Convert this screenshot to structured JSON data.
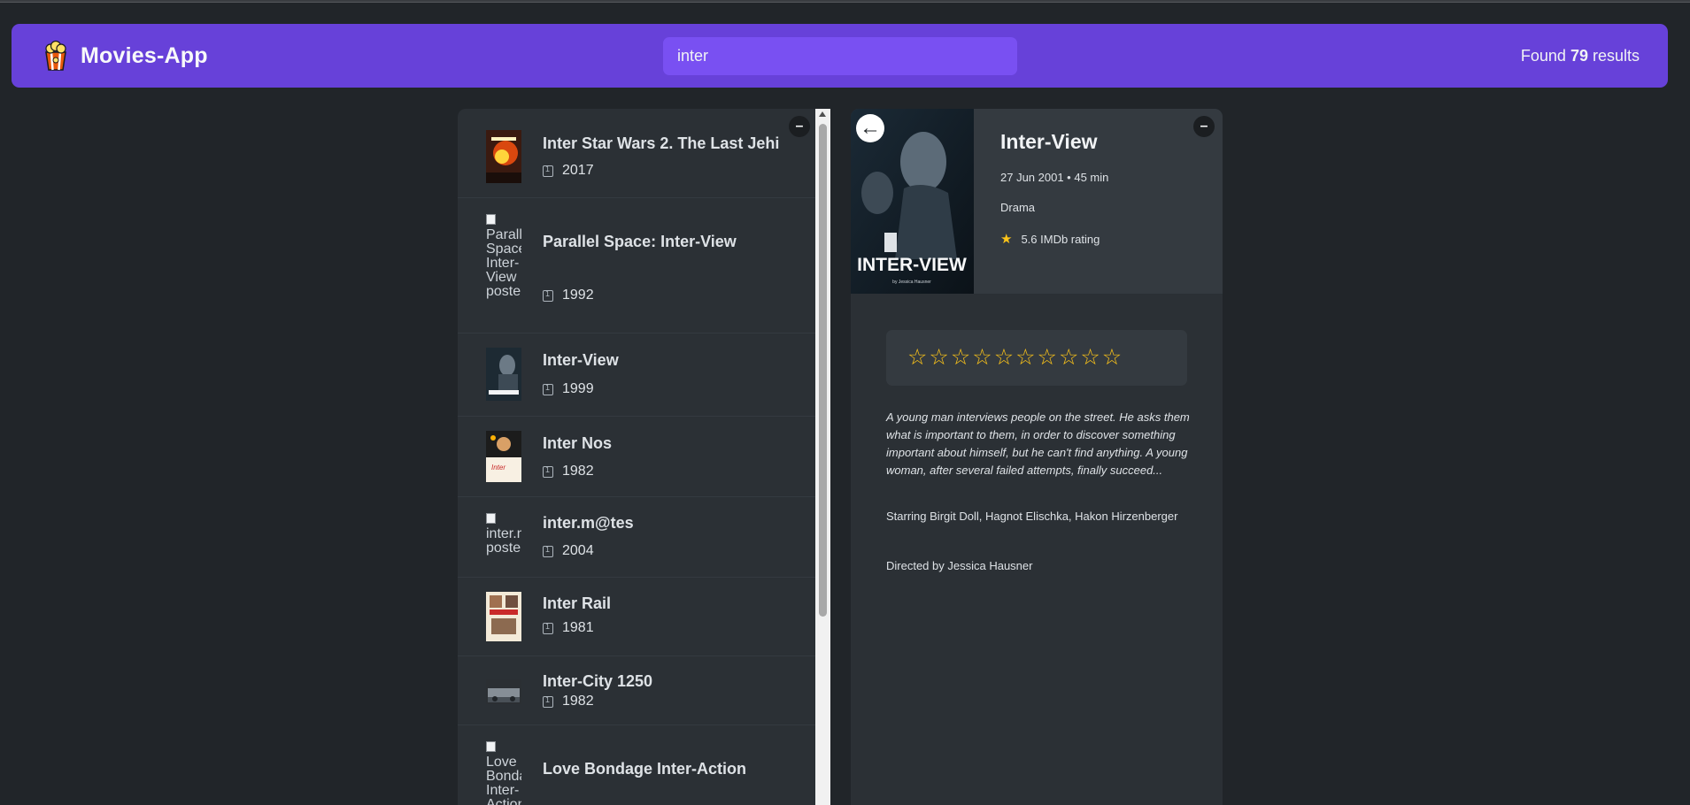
{
  "app": {
    "name": "Movies-App"
  },
  "search": {
    "value": "inter"
  },
  "results": {
    "prefix": "Found",
    "count": "79",
    "suffix": "results"
  },
  "list": {
    "toggle": "–",
    "movies": [
      {
        "title": "Inter Star Wars 2. The Last Jehi",
        "year": "2017",
        "poster_alt": ""
      },
      {
        "title": "Parallel Space: Inter-View",
        "year": "1992",
        "poster_alt": "Parallel Space: Inter-View poster"
      },
      {
        "title": "Inter-View",
        "year": "1999",
        "poster_alt": ""
      },
      {
        "title": "Inter Nos",
        "year": "1982",
        "poster_alt": ""
      },
      {
        "title": "inter.m@tes",
        "year": "2004",
        "poster_alt": "inter.m@tes poster"
      },
      {
        "title": "Inter Rail",
        "year": "1981",
        "poster_alt": ""
      },
      {
        "title": "Inter-City 1250",
        "year": "1982",
        "poster_alt": ""
      },
      {
        "title": "Love Bondage Inter-Action",
        "year": "",
        "poster_alt": "Love Bondage Inter-Action poster"
      }
    ]
  },
  "details": {
    "toggle": "–",
    "back_label": "←",
    "title": "Inter-View",
    "meta": "27 Jun 2001 • 45 min",
    "genre": "Drama",
    "imdb": "5.6 IMDb rating",
    "poster_text": "INTER-VIEW",
    "poster_subtext": "by Jessica Hausner",
    "user_rating_max": 10,
    "star_char": "☆",
    "plot": "A young man interviews people on the street. He asks them what is important to them, in order to discover something important about himself, but he can't find anything. A young woman, after several failed attempts, finally succeed...",
    "starring": "Starring Birgit Doll, Hagnot Elischka, Hakon Hirzenberger",
    "directed": "Directed by Jessica Hausner"
  },
  "colors": {
    "background": "#212529",
    "navbar": "#6741d9",
    "search": "#7950f2",
    "box": "#2b3035",
    "accent_star": "#fcc419"
  },
  "icons": [
    "popcorn-icon",
    "calendar-icon",
    "star-icon",
    "back-arrow-icon"
  ]
}
